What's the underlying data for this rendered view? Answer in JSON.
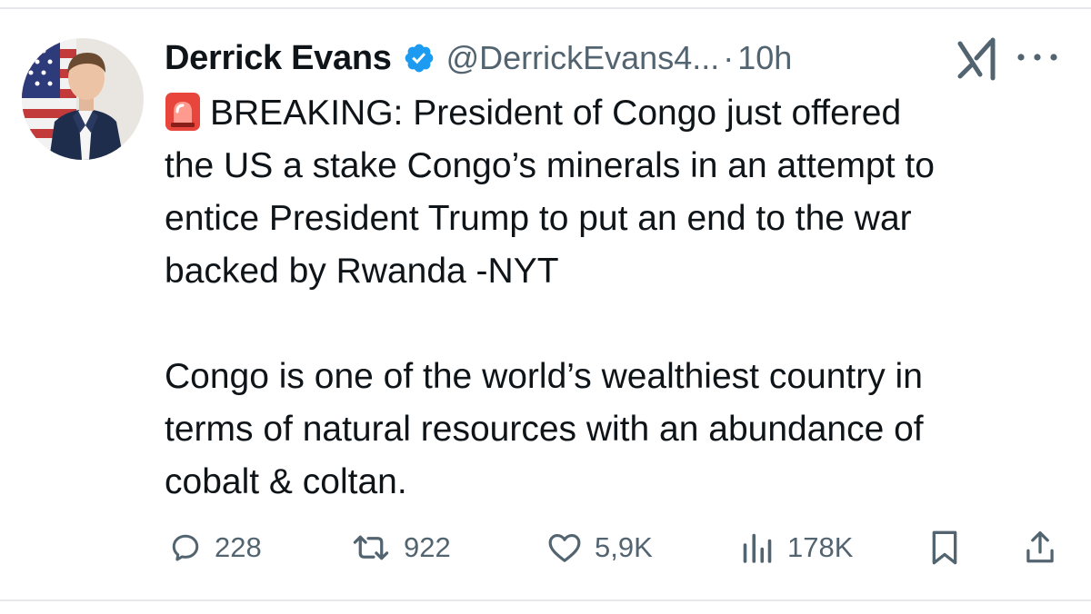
{
  "tweet": {
    "author_name": "Derrick Evans",
    "verified": true,
    "handle": "@DerrickEvans4...",
    "separator": "·",
    "time": "10h",
    "emoji": "rotating-light-icon",
    "text_breaking": "BREAKING: President of Congo just offered\nthe US a stake Congo’s minerals in an attempt to\nentice President Trump to put an end to the war\nbacked by Rwanda -NYT\n\nCongo is one of the world’s wealthiest country in\nterms of natural resources with an abundance of\ncobalt & coltan."
  },
  "actions": {
    "replies": "228",
    "reposts": "922",
    "likes": "5,9K",
    "views": "178K"
  },
  "colors": {
    "text": "#0f1419",
    "muted": "#536471",
    "verified": "#1d9bf0",
    "divider": "#e6e8eb"
  }
}
